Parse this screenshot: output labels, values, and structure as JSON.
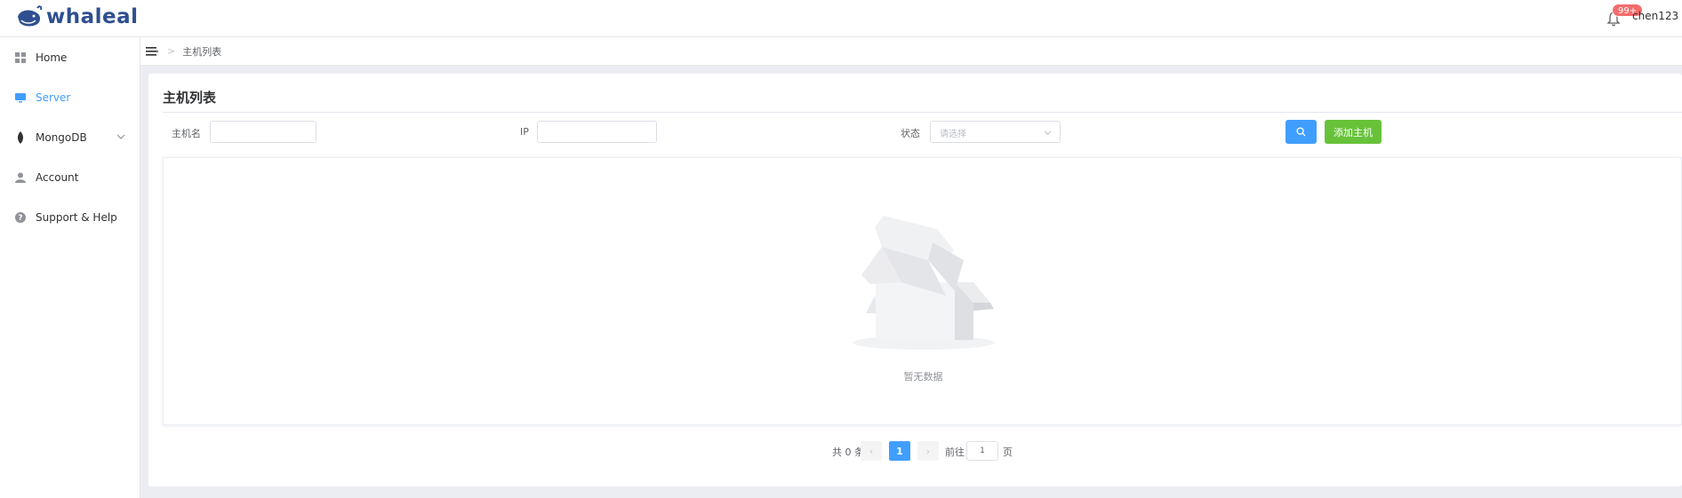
{
  "header": {
    "logo_text": "whaleal",
    "notification_badge": "99+",
    "username": "chen123"
  },
  "sidebar": {
    "items": [
      {
        "label": "Home",
        "icon": "grid-icon"
      },
      {
        "label": "Server",
        "icon": "monitor-icon",
        "active": true
      },
      {
        "label": "MongoDB",
        "icon": "leaf-icon",
        "has_submenu": true
      },
      {
        "label": "Account",
        "icon": "user-icon"
      },
      {
        "label": "Support & Help",
        "icon": "question-icon"
      }
    ]
  },
  "breadcrumb": {
    "separator": ">",
    "current": "主机列表"
  },
  "page": {
    "title": "主机列表",
    "filters": {
      "hostname_label": "主机名",
      "hostname_value": "",
      "ip_label": "IP",
      "ip_value": "",
      "status_label": "状态",
      "status_placeholder": "请选择"
    },
    "add_button": "添加主机",
    "empty_text": "暂无数据"
  },
  "pagination": {
    "total_text": "共 0 条",
    "current_page": "1",
    "prev": "‹",
    "next": "›",
    "goto_label": "前往",
    "goto_value": "1",
    "page_suffix": "页"
  },
  "colors": {
    "primary": "#409eff",
    "success": "#67c23a",
    "danger": "#f56c6c",
    "brand": "#2f4f8f"
  }
}
